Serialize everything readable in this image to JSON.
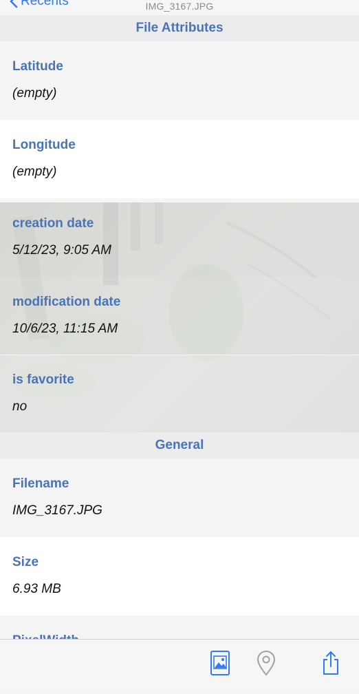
{
  "nav": {
    "back_label": "Recents",
    "subtitle": "IMG_3167.JPG"
  },
  "sections": {
    "file_attributes": "File Attributes",
    "general": "General"
  },
  "rows": {
    "latitude": {
      "label": "Latitude",
      "value": "(empty)"
    },
    "longitude": {
      "label": "Longitude",
      "value": "(empty)"
    },
    "creation_date": {
      "label": "creation date",
      "value": "5/12/23, 9:05 AM"
    },
    "modification_date": {
      "label": "modification date",
      "value": "10/6/23, 11:15 AM"
    },
    "is_favorite": {
      "label": "is favorite",
      "value": "no"
    },
    "filename": {
      "label": "Filename",
      "value": "IMG_3167.JPG"
    },
    "size": {
      "label": "Size",
      "value": "6.93 MB"
    },
    "pixel_width": {
      "label": "PixelWidth"
    }
  },
  "toolbar": {
    "icons": [
      "photo-icon",
      "location-pin-icon",
      "share-icon"
    ],
    "accent": "#2f7af8"
  },
  "colors": {
    "label": "#4a74b5",
    "section_bg": "#ececee"
  }
}
